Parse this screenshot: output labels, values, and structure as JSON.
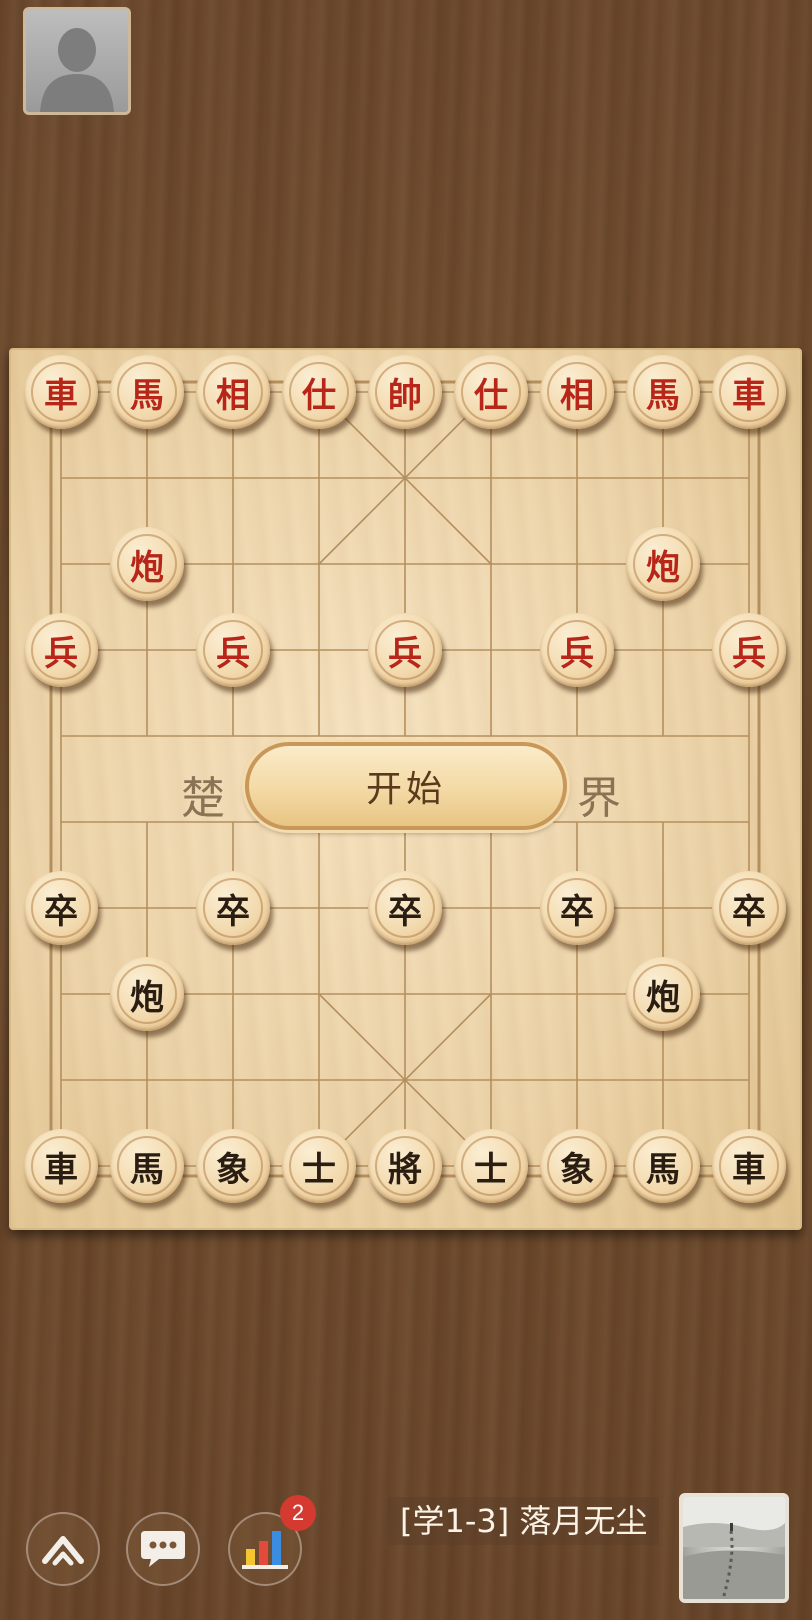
{
  "opponent": {
    "avatar_icon": "default-user-icon"
  },
  "board": {
    "river_left": "楚",
    "river_right": "界",
    "start_button": "开始",
    "grid_color": "#b48f5e"
  },
  "pieces": {
    "top_back_rank": [
      "車",
      "馬",
      "相",
      "仕",
      "帥",
      "仕",
      "相",
      "馬",
      "車"
    ],
    "top_cannons": [
      "炮",
      "炮"
    ],
    "top_soldiers": [
      "兵",
      "兵",
      "兵",
      "兵",
      "兵"
    ],
    "bottom_soldiers": [
      "卒",
      "卒",
      "卒",
      "卒",
      "卒"
    ],
    "bottom_cannons": [
      "炮",
      "炮"
    ],
    "bottom_back_rank": [
      "車",
      "馬",
      "象",
      "士",
      "將",
      "士",
      "象",
      "馬",
      "車"
    ],
    "red_color": "#b8261a",
    "black_color": "#2a1d12"
  },
  "toolbar": {
    "menu_icon": "expand-up-icon",
    "chat_icon": "chat-bubble-icon",
    "stats_icon": "bar-chart-icon",
    "stats_badge": "2"
  },
  "player": {
    "name": "[学1-3] 落月无尘",
    "avatar_icon": "landscape-avatar-icon"
  }
}
